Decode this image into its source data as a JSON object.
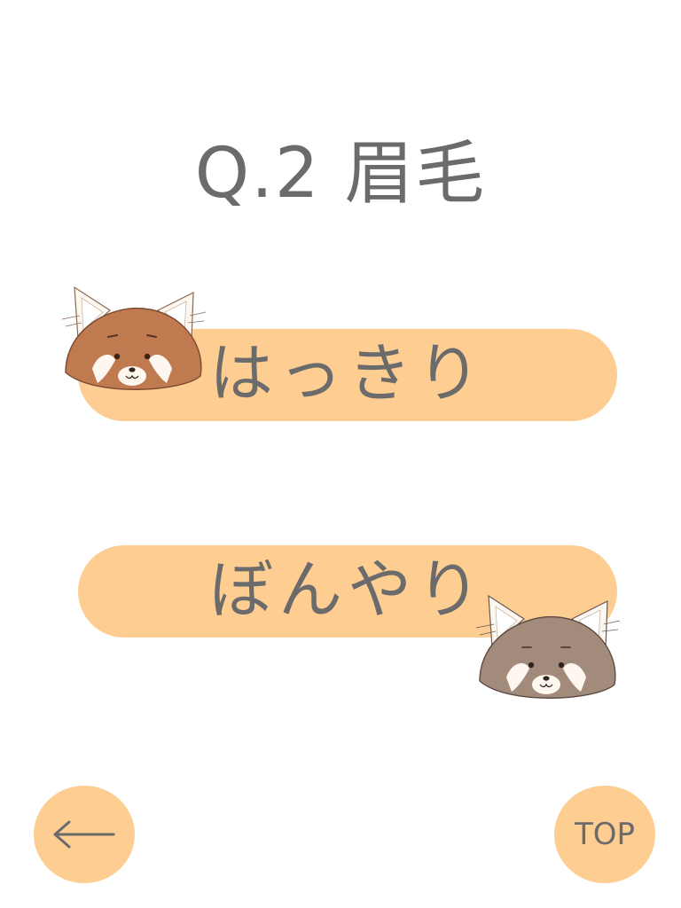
{
  "question": {
    "title": "Q.2 眉毛"
  },
  "answers": [
    {
      "label": "はっきり"
    },
    {
      "label": "ぼんやり"
    }
  ],
  "navigation": {
    "back_icon": "left-arrow-icon",
    "top_label": "TOP"
  },
  "colors": {
    "button_fill": "#fecd92",
    "text": "#6b6b6b",
    "panda_red": "#c07a50",
    "panda_grey": "#a38b7c"
  }
}
